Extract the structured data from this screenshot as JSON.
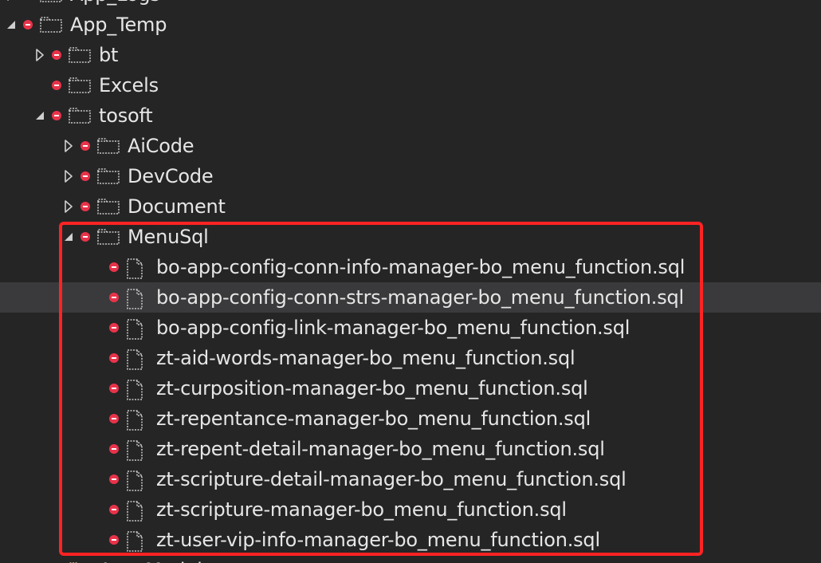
{
  "tree": {
    "rows": [
      {
        "label": "App_Logs",
        "depth": 0,
        "type": "folder",
        "expander": "collapsed"
      },
      {
        "label": "App_Temp",
        "depth": 0,
        "type": "folder",
        "expander": "expanded"
      },
      {
        "label": "bt",
        "depth": 1,
        "type": "folder",
        "expander": "collapsed"
      },
      {
        "label": "Excels",
        "depth": 1,
        "type": "folder",
        "expander": "none"
      },
      {
        "label": "tosoft",
        "depth": 1,
        "type": "folder",
        "expander": "expanded"
      },
      {
        "label": "AiCode",
        "depth": 2,
        "type": "folder",
        "expander": "collapsed"
      },
      {
        "label": "DevCode",
        "depth": 2,
        "type": "folder",
        "expander": "collapsed"
      },
      {
        "label": "Document",
        "depth": 2,
        "type": "folder",
        "expander": "collapsed"
      },
      {
        "label": "MenuSql",
        "depth": 2,
        "type": "folder",
        "expander": "expanded"
      },
      {
        "label": "bo-app-config-conn-info-manager-bo_menu_function.sql",
        "depth": 3,
        "type": "file",
        "expander": "none"
      },
      {
        "label": "bo-app-config-conn-strs-manager-bo_menu_function.sql",
        "depth": 3,
        "type": "file",
        "expander": "none",
        "selected": true
      },
      {
        "label": "bo-app-config-link-manager-bo_menu_function.sql",
        "depth": 3,
        "type": "file",
        "expander": "none"
      },
      {
        "label": "zt-aid-words-manager-bo_menu_function.sql",
        "depth": 3,
        "type": "file",
        "expander": "none"
      },
      {
        "label": "zt-curposition-manager-bo_menu_function.sql",
        "depth": 3,
        "type": "file",
        "expander": "none"
      },
      {
        "label": "zt-repentance-manager-bo_menu_function.sql",
        "depth": 3,
        "type": "file",
        "expander": "none"
      },
      {
        "label": "zt-repent-detail-manager-bo_menu_function.sql",
        "depth": 3,
        "type": "file",
        "expander": "none"
      },
      {
        "label": "zt-scripture-detail-manager-bo_menu_function.sql",
        "depth": 3,
        "type": "file",
        "expander": "none"
      },
      {
        "label": "zt-scripture-manager-bo_menu_function.sql",
        "depth": 3,
        "type": "file",
        "expander": "none"
      },
      {
        "label": "zt-user-vip-info-manager-bo_menu_function.sql",
        "depth": 3,
        "type": "file",
        "expander": "none"
      },
      {
        "label": "App_Modules",
        "depth": 1,
        "type": "folder",
        "expander": "none",
        "iconColor": "#dcb67a"
      }
    ],
    "colors": {
      "background": "#252526",
      "selected_row": "#3a3a3c",
      "text": "#e6e6e6",
      "status_badge": "#e8334a",
      "highlight_border": "#ff2323",
      "folder_icon_stroke": "#c8c8c8"
    },
    "icons": {
      "folder": "folder-icon",
      "file": "file-icon",
      "collapsed": "chevron-right-icon",
      "expanded": "caret-down-icon",
      "status": "excluded-status-icon"
    }
  }
}
